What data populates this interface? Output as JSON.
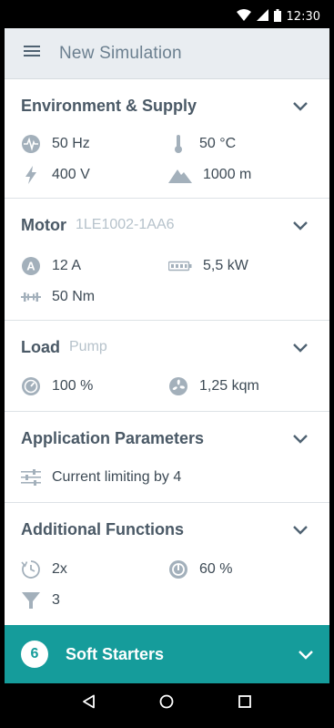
{
  "status_bar": {
    "time": "12:30"
  },
  "app_bar": {
    "title": "New Simulation"
  },
  "sections": {
    "environment": {
      "title": "Environment & Supply",
      "frequency": "50 Hz",
      "temperature": "50 °C",
      "voltage": "400 V",
      "altitude": "1000 m"
    },
    "motor": {
      "title": "Motor",
      "subtitle": "1LE1002-1AA6",
      "current": "12 A",
      "power": "5,5 kW",
      "torque": "50 Nm"
    },
    "load": {
      "title": "Load",
      "subtitle": "Pump",
      "load_percent": "100 %",
      "inertia": "1,25 kqm"
    },
    "application": {
      "title": "Application Parameters",
      "current_limiting": "Current limiting by 4"
    },
    "additional": {
      "title": "Additional Functions",
      "starts": "2x",
      "duty": "60 %",
      "filter": "3"
    }
  },
  "footer": {
    "badge": "6",
    "title": "Soft Starters"
  },
  "colors": {
    "accent": "#159c9b",
    "icon": "#a3b0bb",
    "title": "#4a5966",
    "appbar_bg": "#e9edf1"
  },
  "icons": {
    "status": [
      "wifi-icon",
      "signal-icon",
      "battery-icon"
    ],
    "nav": [
      "back-icon",
      "home-icon",
      "recents-icon"
    ]
  }
}
